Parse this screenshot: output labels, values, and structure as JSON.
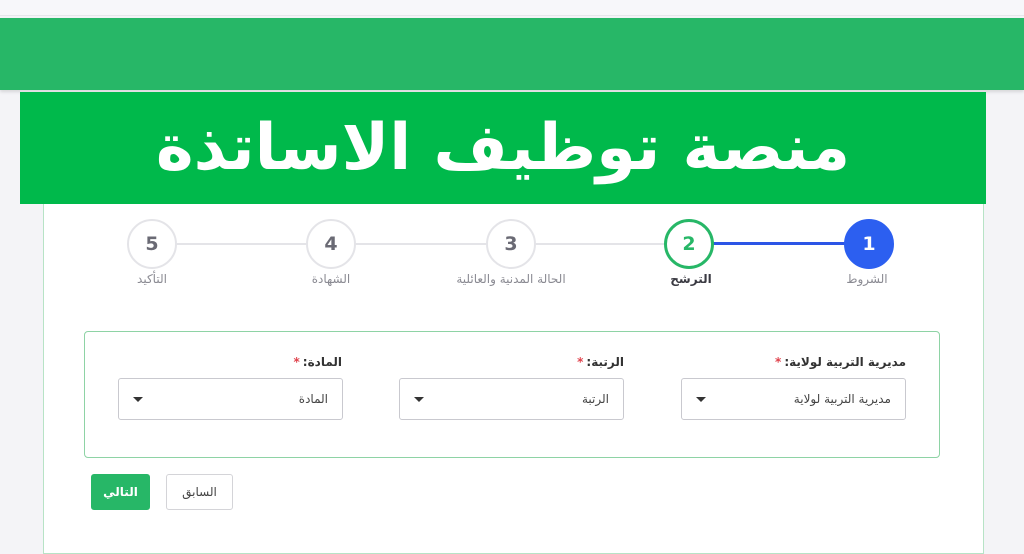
{
  "banner": {
    "title": "منصة توظيف الاساتذة"
  },
  "stepper": {
    "steps": [
      {
        "number": "1",
        "label": "الشروط",
        "state": "done"
      },
      {
        "number": "2",
        "label": "الترشح",
        "state": "current"
      },
      {
        "number": "3",
        "label": "الحالة المدنية والعائلية",
        "state": "pending"
      },
      {
        "number": "4",
        "label": "الشهادة",
        "state": "pending"
      },
      {
        "number": "5",
        "label": "التأكيد",
        "state": "pending"
      }
    ]
  },
  "form": {
    "directorate": {
      "label": "مديرية التربية لولاية:",
      "required_mark": "*",
      "value": "مديرية التربية لولاية"
    },
    "rank": {
      "label": "الرتبة:",
      "required_mark": "*",
      "value": "الرتبة"
    },
    "subject": {
      "label": "المادة:",
      "required_mark": "*",
      "value": "المادة"
    }
  },
  "actions": {
    "next_label": "التالي",
    "previous_label": "السابق"
  },
  "colors": {
    "brand_green": "#27b767",
    "banner_green": "#00b94b",
    "step_blue": "#2c5ff0",
    "required_red": "#e0434d"
  }
}
